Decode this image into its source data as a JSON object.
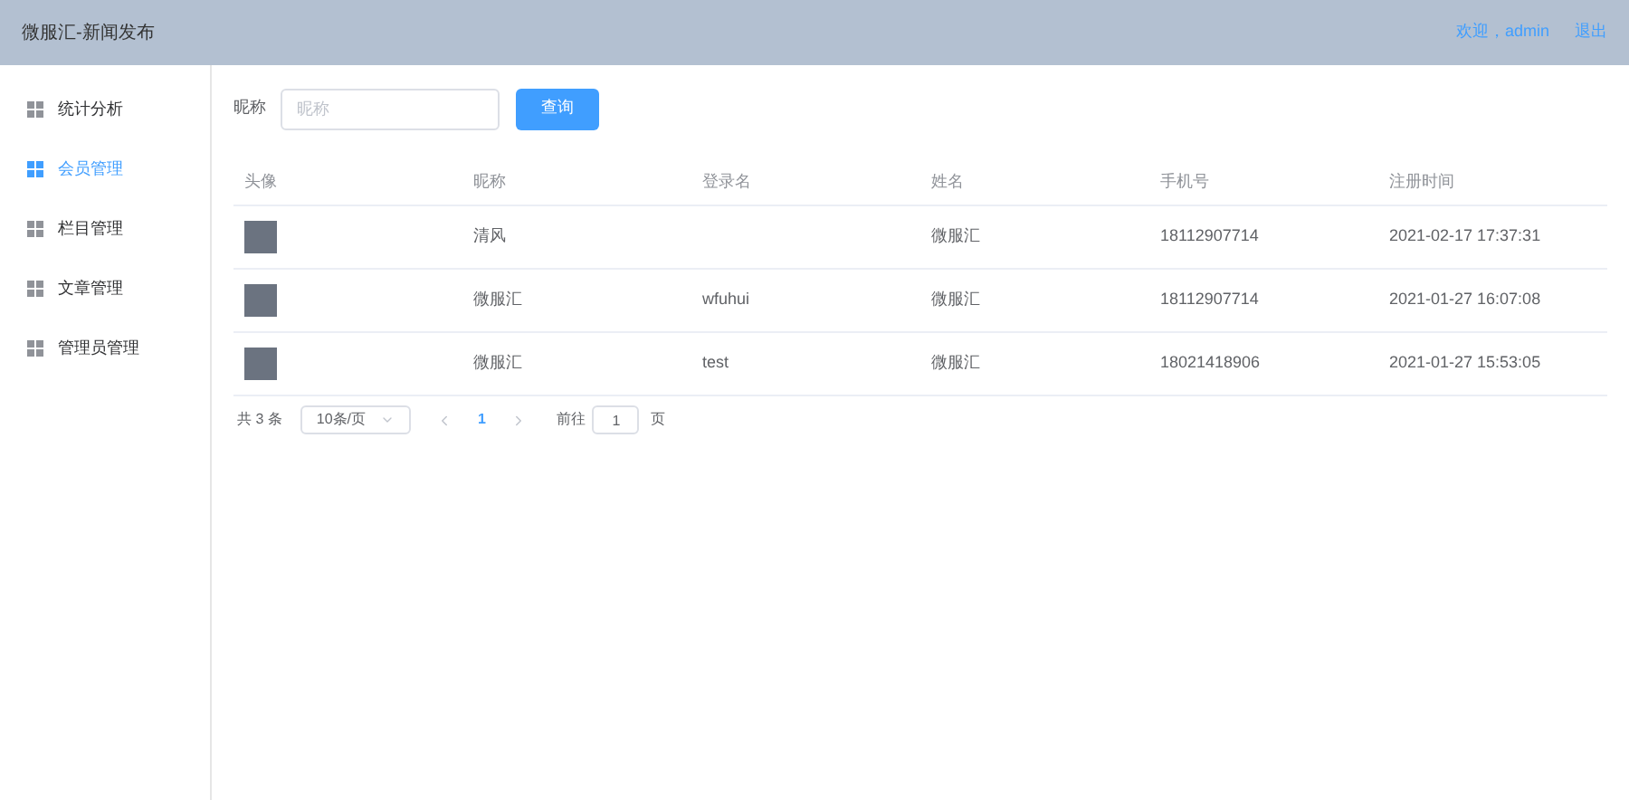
{
  "header": {
    "title": "微服汇-新闻发布",
    "welcome": "欢迎，admin",
    "logout": "退出"
  },
  "sidebar": {
    "items": [
      {
        "label": "统计分析",
        "selected": false
      },
      {
        "label": "会员管理",
        "selected": true
      },
      {
        "label": "栏目管理",
        "selected": false
      },
      {
        "label": "文章管理",
        "selected": false
      },
      {
        "label": "管理员管理",
        "selected": false
      }
    ]
  },
  "search": {
    "label": "昵称",
    "placeholder": "昵称",
    "button": "查询"
  },
  "table": {
    "columns": [
      "头像",
      "昵称",
      "登录名",
      "姓名",
      "手机号",
      "注册时间"
    ],
    "rows": [
      [
        "",
        "清风",
        "",
        "微服汇",
        "18112907714",
        "2021-02-17 17:37:31"
      ],
      [
        "",
        "微服汇",
        "wfuhui",
        "微服汇",
        "18112907714",
        "2021-01-27 16:07:08"
      ],
      [
        "",
        "微服汇",
        "test",
        "微服汇",
        "18021418906",
        "2021-01-27 15:53:05"
      ]
    ]
  },
  "pagination": {
    "total": "共 3 条",
    "page_size": "10条/页",
    "pages": [
      {
        "label": "1",
        "selected": true
      }
    ],
    "goto_label": "前往",
    "goto_value": "1",
    "goto_suffix": "页"
  }
}
